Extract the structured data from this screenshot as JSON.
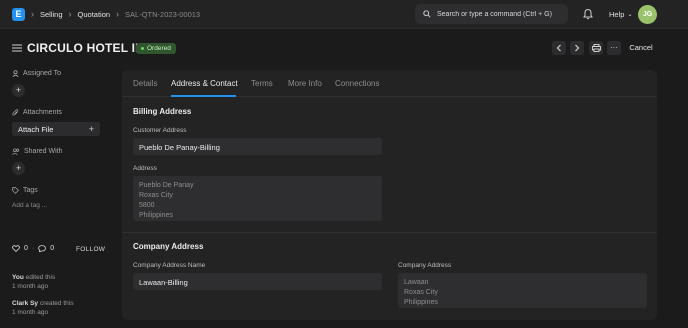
{
  "navbar": {
    "logo": "E",
    "breadcrumbs": [
      "Selling",
      "Quotation",
      "SAL-QTN-2023-00013"
    ],
    "search_placeholder": "Search or type a command (Ctrl + G)",
    "help_label": "Help",
    "avatar_initials": "JG"
  },
  "header": {
    "title": "CIRCULO HOTEL INC.",
    "status": "Ordered",
    "cancel_label": "Cancel"
  },
  "sidebar": {
    "assigned_to": "Assigned To",
    "attachments": "Attachments",
    "attach_file": "Attach File",
    "shared_with": "Shared With",
    "tags": "Tags",
    "add_tag": "Add a tag ...",
    "likes": "0",
    "comments": "0",
    "follow": "FOLLOW",
    "activity": [
      {
        "user": "You",
        "action": " edited this",
        "time": "1 month ago"
      },
      {
        "user": "Clark Sy",
        "action": " created this",
        "time": "1 month ago"
      }
    ]
  },
  "tabs": [
    "Details",
    "Address & Contact",
    "Terms",
    "More Info",
    "Connections"
  ],
  "billing": {
    "section_title": "Billing Address",
    "customer_address_label": "Customer Address",
    "customer_address_value": "Pueblo De Panay-Billing",
    "address_label": "Address",
    "address_lines": [
      "Pueblo De Panay",
      "Roxas City",
      "5800",
      "Philippines"
    ]
  },
  "company": {
    "section_title": "Company Address",
    "name_label": "Company Address Name",
    "name_value": "Lawaan-Billing",
    "address_label": "Company Address",
    "address_lines": [
      "Lawaan",
      "Roxas City",
      "Philippines"
    ]
  },
  "colors": {
    "accent": "#2490ef",
    "status_bg": "#30562d",
    "avatar": "#9ac26b"
  }
}
